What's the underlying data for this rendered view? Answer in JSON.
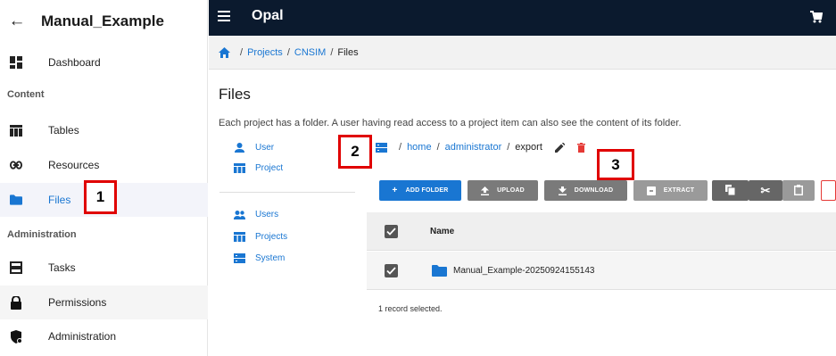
{
  "drawer": {
    "title": "Manual_Example",
    "dashboard": "Dashboard",
    "section_content": "Content",
    "tables": "Tables",
    "resources": "Resources",
    "files": "Files",
    "section_admin": "Administration",
    "tasks": "Tasks",
    "permissions": "Permissions",
    "administration": "Administration"
  },
  "appbar": {
    "title": "Opal"
  },
  "breadcrumb": {
    "projects": "Projects",
    "project": "CNSIM",
    "current": "Files"
  },
  "main": {
    "title": "Files",
    "description": "Each project has a folder. A user having read access to a project item can also see the content of its folder."
  },
  "file_nav": {
    "user": "User",
    "project": "Project",
    "users": "Users",
    "projects": "Projects",
    "system": "System"
  },
  "path": {
    "home": "home",
    "admin": "administrator",
    "current": "export"
  },
  "toolbar": {
    "add_folder": "ADD FOLDER",
    "upload": "UPLOAD",
    "download": "DOWNLOAD",
    "extract": "EXTRACT"
  },
  "table": {
    "header_name": "Name",
    "rows": [
      {
        "name": "Manual_Example-20250924155143",
        "selected": true
      }
    ],
    "status": "1 record selected."
  },
  "annotations": {
    "a1": "1",
    "a2": "2",
    "a3": "3"
  },
  "colors": {
    "accent": "#1976d2",
    "appbar": "#0b1a2e",
    "annotation": "#e00000",
    "delete": "#e53935"
  }
}
